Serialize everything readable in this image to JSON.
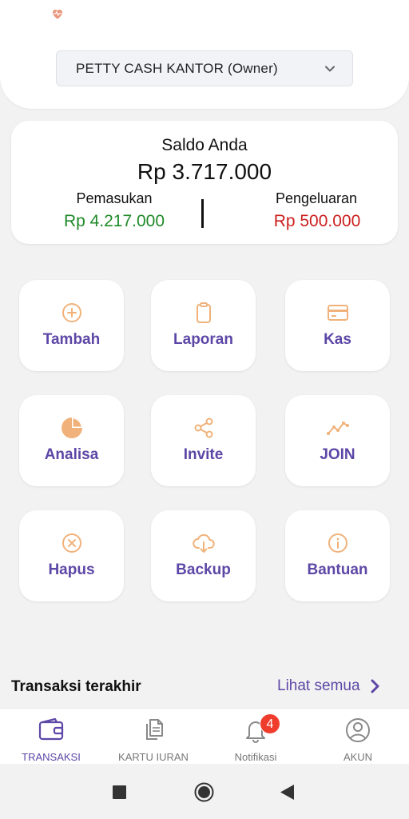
{
  "colors": {
    "accent": "#5d47a6",
    "icon_orange": "#f0b27a",
    "income_green": "#1e8a28",
    "expense_red": "#cc1f1f",
    "badge_red": "#ef3c2d"
  },
  "header": {
    "logo_icon": "heart-pulse-icon",
    "account_select": {
      "selected": "PETTY CASH KANTOR (Owner)",
      "icon": "chevron-down-icon"
    }
  },
  "balance": {
    "title": "Saldo Anda",
    "value": "Rp 3.717.000",
    "income_label": "Pemasukan",
    "income_value": "Rp 4.217.000",
    "expense_label": "Pengeluaran",
    "expense_value": "Rp 500.000"
  },
  "menu": [
    {
      "label": "Tambah",
      "icon": "plus-circle-icon"
    },
    {
      "label": "Laporan",
      "icon": "clipboard-icon"
    },
    {
      "label": "Kas",
      "icon": "credit-card-icon"
    },
    {
      "label": "Analisa",
      "icon": "pie-chart-icon"
    },
    {
      "label": "Invite",
      "icon": "share-icon"
    },
    {
      "label": "JOIN",
      "icon": "trending-line-icon"
    },
    {
      "label": "Hapus",
      "icon": "x-circle-icon"
    },
    {
      "label": "Backup",
      "icon": "cloud-download-icon"
    },
    {
      "label": "Bantuan",
      "icon": "info-circle-icon"
    }
  ],
  "recent": {
    "title": "Transaksi terakhir",
    "see_all": "Lihat semua"
  },
  "bottom_nav": [
    {
      "label": "TRANSAKSI",
      "icon": "wallet-icon",
      "active": true
    },
    {
      "label": "KARTU IURAN",
      "icon": "documents-icon",
      "active": false
    },
    {
      "label": "Notifikasi",
      "icon": "bell-icon",
      "active": false,
      "badge": "4"
    },
    {
      "label": "AKUN",
      "icon": "user-circle-icon",
      "active": false
    }
  ],
  "system_nav": [
    "recents-square-icon",
    "home-circle-icon",
    "back-triangle-icon"
  ]
}
